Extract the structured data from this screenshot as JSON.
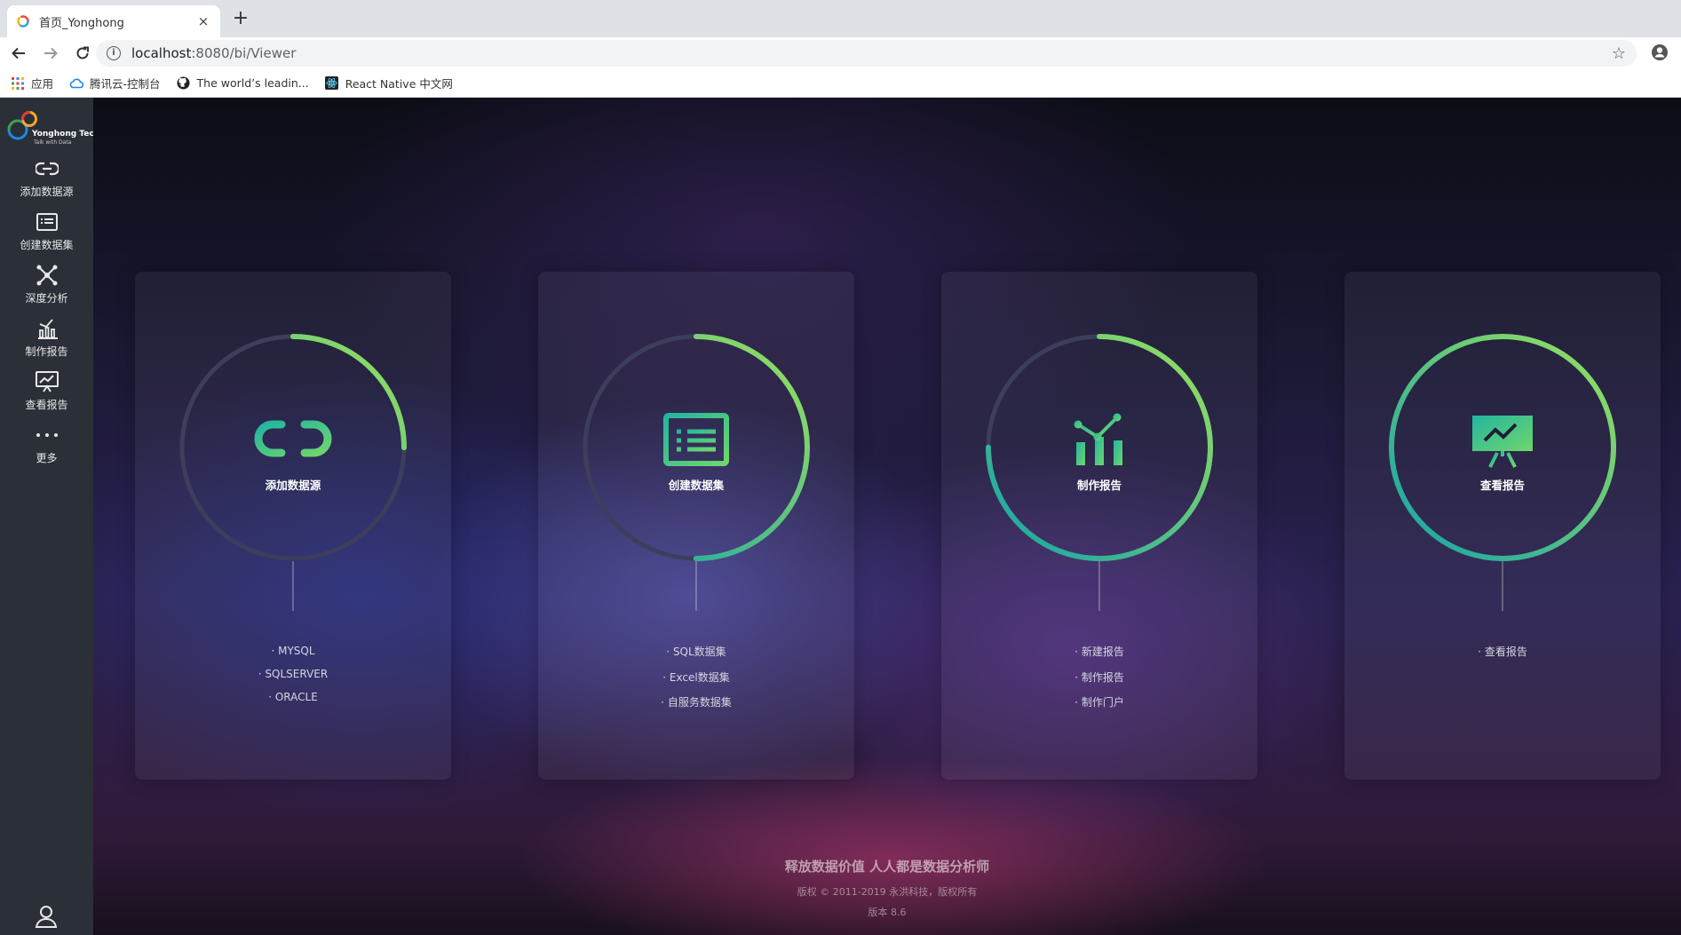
{
  "browser": {
    "tab_title": "首页_Yonghong",
    "tab_close": "×",
    "new_tab": "+",
    "url_host": "localhost",
    "url_path": ":8080/bi/Viewer",
    "bookmarks": [
      {
        "label": "应用",
        "icon": "apps-grid-icon"
      },
      {
        "label": "腾讯云-控制台",
        "icon": "tencent-cloud-icon"
      },
      {
        "label": "The world’s leadin...",
        "icon": "github-icon"
      },
      {
        "label": "React Native 中文网",
        "icon": "react-icon"
      }
    ]
  },
  "sidebar": {
    "logo_name": "Yonghong Tech",
    "logo_slogan": "Talk with Data",
    "items": [
      {
        "label": "添加数据源",
        "icon": "link-icon"
      },
      {
        "label": "创建数据集",
        "icon": "dataset-icon"
      },
      {
        "label": "深度分析",
        "icon": "network-icon"
      },
      {
        "label": "制作报告",
        "icon": "bar-chart-icon"
      },
      {
        "label": "查看报告",
        "icon": "presentation-icon"
      },
      {
        "label": "更多",
        "icon": "more-icon"
      }
    ],
    "user_icon": "user-icon"
  },
  "cards": [
    {
      "title": "添加数据源",
      "icon": "link-icon",
      "progress": 0.25,
      "links": [
        "MYSQL",
        "SQLSERVER",
        "ORACLE"
      ]
    },
    {
      "title": "创建数据集",
      "icon": "dataset-icon",
      "progress": 0.5,
      "links": [
        "SQL数据集",
        "Excel数据集",
        "自服务数据集"
      ]
    },
    {
      "title": "制作报告",
      "icon": "bar-chart-icon",
      "progress": 0.75,
      "links": [
        "新建报告",
        "制作报告",
        "制作门户"
      ]
    },
    {
      "title": "查看报告",
      "icon": "presentation-icon",
      "progress": 1.0,
      "links": [
        "查看报告"
      ]
    }
  ],
  "footer": {
    "slogan": "释放数据价值 人人都是数据分析师",
    "copyright": "版权 © 2011-2019 永洪科技，版权所有",
    "version": "版本 8.6"
  },
  "colors": {
    "sidebar_bg": "#2b2f37",
    "ring_start": "#16a5a6",
    "ring_end": "#9be15d",
    "ring_track": "#3d3e5c",
    "icon_green": "#3ec48b"
  }
}
